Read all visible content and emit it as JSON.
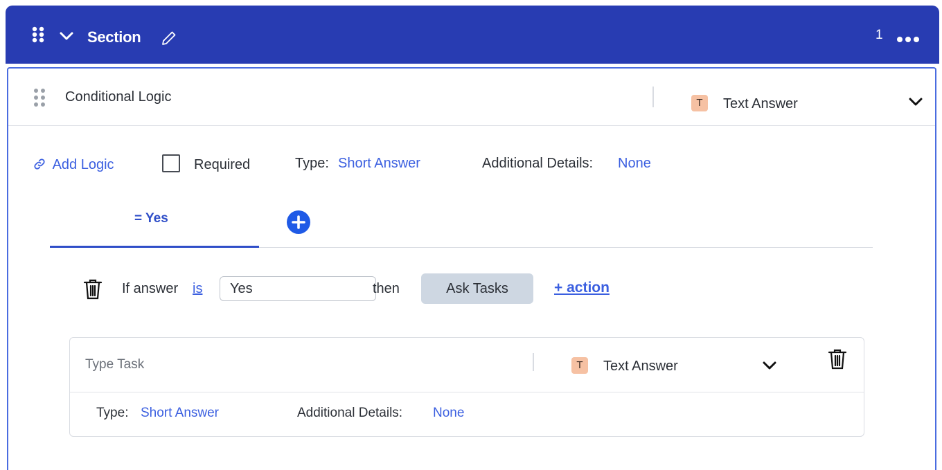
{
  "section": {
    "title": "Section",
    "count": "1",
    "header_color": "#283cb2",
    "icons": [
      "drag-handle-icon",
      "chevron-down-icon",
      "pencil-icon",
      "more-horizontal-icon"
    ]
  },
  "question": {
    "title": "Conditional Logic",
    "answer_badge": "T",
    "answer_type": "Text Answer",
    "add_logic_label": "Add Logic",
    "required_label": "Required",
    "required_checked": false,
    "type_label": "Type:",
    "type_value": "Short Answer",
    "additional_label": "Additional Details:",
    "additional_value": "None"
  },
  "logic_tabs": [
    {
      "label": "= Yes",
      "active": true
    }
  ],
  "condition": {
    "prefix": "If answer",
    "operator": "is",
    "value": "Yes",
    "then_label": "then",
    "action_button": "Ask Tasks",
    "add_action_label": "+ action"
  },
  "task": {
    "placeholder": "Type Task",
    "answer_badge": "T",
    "answer_type": "Text Answer",
    "type_label": "Type:",
    "type_value": "Short Answer",
    "additional_label": "Additional Details:",
    "additional_value": "None"
  },
  "colors": {
    "accent": "#3b5fe0",
    "badge": "#f6c1a3",
    "button": "#ced7e2"
  }
}
